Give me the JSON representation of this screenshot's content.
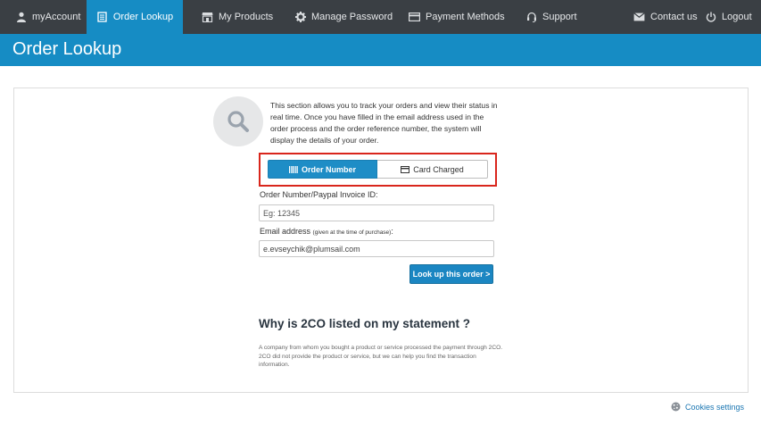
{
  "nav": {
    "items": [
      {
        "label": "myAccount",
        "icon": "user-icon"
      },
      {
        "label": "Order Lookup",
        "icon": "document-icon"
      },
      {
        "label": "My Products",
        "icon": "store-icon"
      },
      {
        "label": "Manage Password",
        "icon": "gear-icon"
      },
      {
        "label": "Payment Methods",
        "icon": "credit-card-icon"
      },
      {
        "label": "Support",
        "icon": "headset-icon"
      }
    ],
    "right": [
      {
        "label": "Contact us",
        "icon": "envelope-icon"
      },
      {
        "label": "Logout",
        "icon": "power-icon"
      }
    ],
    "active": "Order Lookup"
  },
  "page": {
    "title": "Order Lookup"
  },
  "lookup": {
    "intro": "This section allows you to track your orders and view their status in real time. Once you have filled in the email address used in the order process and the order reference number, the system will display the details of your order.",
    "tabs": [
      {
        "label": "Order Number",
        "icon": "barcode-icon"
      },
      {
        "label": "Card Charged",
        "icon": "credit-card-icon"
      }
    ],
    "order_label": "Order Number/Paypal Invoice ID:",
    "order_placeholder": "Eg: 12345",
    "order_value": "",
    "email_label": "Email address",
    "email_hint": "(given at the time of purchase)",
    "email_suffix": ":",
    "email_value": "e.evseychik@plumsail.com",
    "submit_label": "Look up this order >"
  },
  "why": {
    "title": "Why is 2CO listed on my statement ?",
    "text": "A company from whom you bought a product or service processed the payment through 2CO. 2CO did not provide the product or service, but we can help you find the transaction information."
  },
  "footer": {
    "cookies_label": "Cookies settings"
  },
  "colors": {
    "nav_bg": "#3a3f44",
    "accent": "#168cc4",
    "highlight": "#d9261c"
  }
}
